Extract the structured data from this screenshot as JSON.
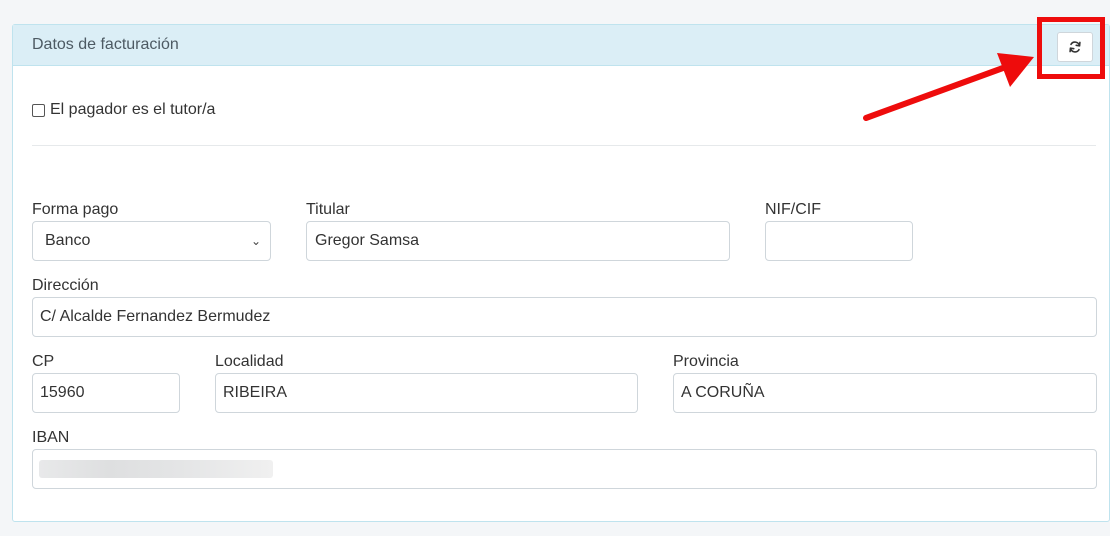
{
  "panel": {
    "title": "Datos de facturación",
    "refresh_icon": "refresh-icon"
  },
  "payer_checkbox": {
    "label": "El pagador es el tutor/a",
    "checked": false
  },
  "form": {
    "forma_pago": {
      "label": "Forma pago",
      "value": "Banco"
    },
    "titular": {
      "label": "Titular",
      "value": "Gregor Samsa"
    },
    "nif_cif": {
      "label": "NIF/CIF",
      "value": ""
    },
    "direccion": {
      "label": "Dirección",
      "value": "C/ Alcalde Fernandez Bermudez"
    },
    "cp": {
      "label": "CP",
      "value": "15960"
    },
    "localidad": {
      "label": "Localidad",
      "value": "RIBEIRA"
    },
    "provincia": {
      "label": "Provincia",
      "value": "A CORUÑA"
    },
    "iban": {
      "label": "IBAN",
      "value": ""
    }
  },
  "colors": {
    "header_bg": "#dbeef6",
    "annotation": "#ee0c0c"
  }
}
